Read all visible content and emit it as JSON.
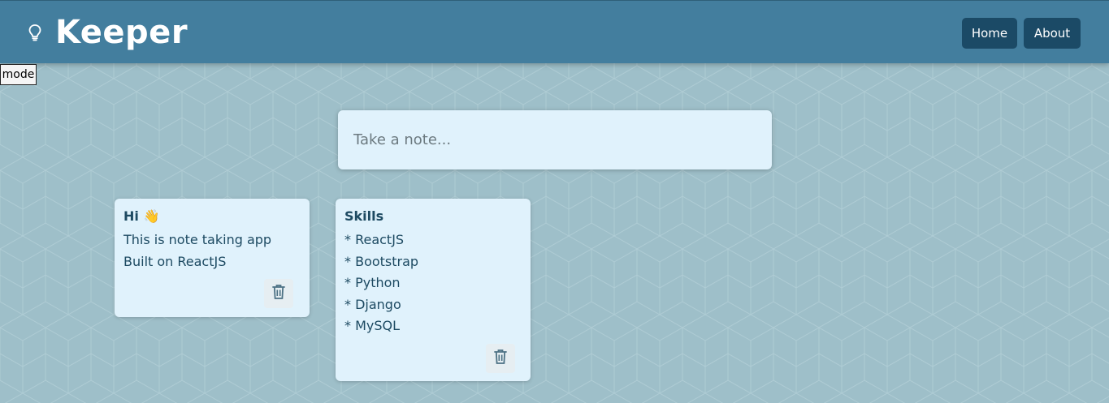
{
  "app": {
    "title": "Keeper",
    "icon": "lightbulb-icon"
  },
  "nav": {
    "home": "Home",
    "about": "About"
  },
  "mode_toggle": "mode",
  "create_note": {
    "placeholder": "Take a note..."
  },
  "notes": [
    {
      "title": "Hi 👋",
      "content": "This is note taking app Built on ReactJS",
      "delete_icon": "trash-icon"
    },
    {
      "title": "Skills",
      "content": "* ReactJS\n* Bootstrap\n* Python\n* Django\n* MySQL",
      "delete_icon": "trash-icon"
    }
  ],
  "colors": {
    "header": "#437e9e",
    "background": "#9ebfc9",
    "note_bg": "#e0f2fc",
    "nav_button": "#1b4a66",
    "text": "#1d4a62"
  }
}
